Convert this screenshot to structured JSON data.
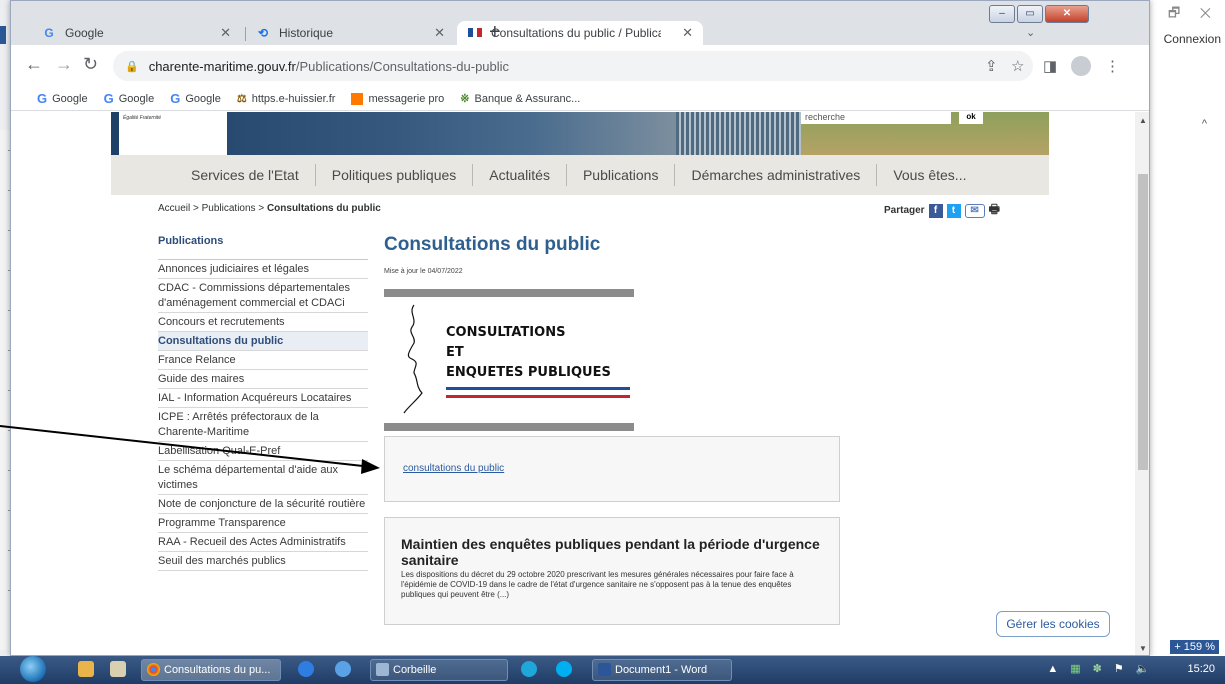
{
  "word": {
    "right_controls": "🗗  ✕",
    "connexion": "Connexion",
    "zoom": "+ 159 %",
    "caret": "^"
  },
  "browser": {
    "tabs": [
      {
        "label": "Google",
        "icon": "google-icon"
      },
      {
        "label": "Historique",
        "icon": "history-icon"
      },
      {
        "label": "Consultations du public / Publica",
        "icon": "flag-icon"
      }
    ],
    "new_tab": "+",
    "url_domain": "charente-maritime.gouv.fr",
    "url_path": "/Publications/Consultations-du-public",
    "bookmarks": [
      {
        "label": "Google",
        "icon": "google-icon"
      },
      {
        "label": "Google",
        "icon": "google-icon"
      },
      {
        "label": "Google",
        "icon": "google-icon"
      },
      {
        "label": "https.e-huissier.fr",
        "icon": "huissier-icon"
      },
      {
        "label": "messagerie pro",
        "icon": "orange-icon"
      },
      {
        "label": "Banque & Assuranc...",
        "icon": "bank-icon"
      }
    ]
  },
  "site": {
    "logo_text": "Égalité Fraternité",
    "search_placeholder": "recherche",
    "search_ok": "ok",
    "nav": [
      "Services de l'Etat",
      "Politiques publiques",
      "Actualités",
      "Publications",
      "Démarches administratives",
      "Vous êtes..."
    ],
    "breadcrumb_prefix": "Accueil > Publications > ",
    "breadcrumb_current": "Consultations du public",
    "share_label": "Partager",
    "sidebar_title": "Publications",
    "sidebar_items": [
      "Annonces judiciaires et légales",
      "CDAC - Commissions départementales d'aménagement commercial et CDACi",
      "Concours et recrutements",
      "Consultations du public",
      "France Relance",
      "Guide des maires",
      "IAL - Information Acquéreurs Locataires",
      "ICPE : Arrêtés préfectoraux de la Charente-Maritime",
      "Labellisation Qual-E-Pref",
      "Le schéma départemental d'aide aux victimes",
      "Note de conjoncture de la sécurité routière",
      "Programme Transparence",
      "RAA - Recueil des Actes Administratifs",
      "Seuil des marchés publics"
    ],
    "selected_index": 3,
    "page_title": "Consultations du public",
    "updated": "Mise à jour le 04/07/2022",
    "hero_line1": "CONSULTATIONS",
    "hero_line2": "ET",
    "hero_line3": "ENQUETES PUBLIQUES",
    "link_text": "consultations du public",
    "news_title": "Maintien des enquêtes publiques pendant la période d'urgence sanitaire",
    "news_body": "Les dispositions du décret du 29 octobre 2020 prescrivant les mesures générales nécessaires pour faire face à l'épidémie de COVID-19 dans le cadre de l'état d'urgence sanitaire ne s'opposent pas à la tenue des enquêtes publiques qui peuvent être (...)",
    "cookies_button": "Gérer les cookies"
  },
  "taskbar": {
    "items": [
      "Consultations du pu...",
      "Corbeille",
      "Document1 - Word"
    ],
    "clock": "15:20"
  },
  "colors": {
    "site_blue": "#2f5f8e",
    "flag_blue": "#1f4e9a",
    "flag_red": "#c1272d"
  }
}
